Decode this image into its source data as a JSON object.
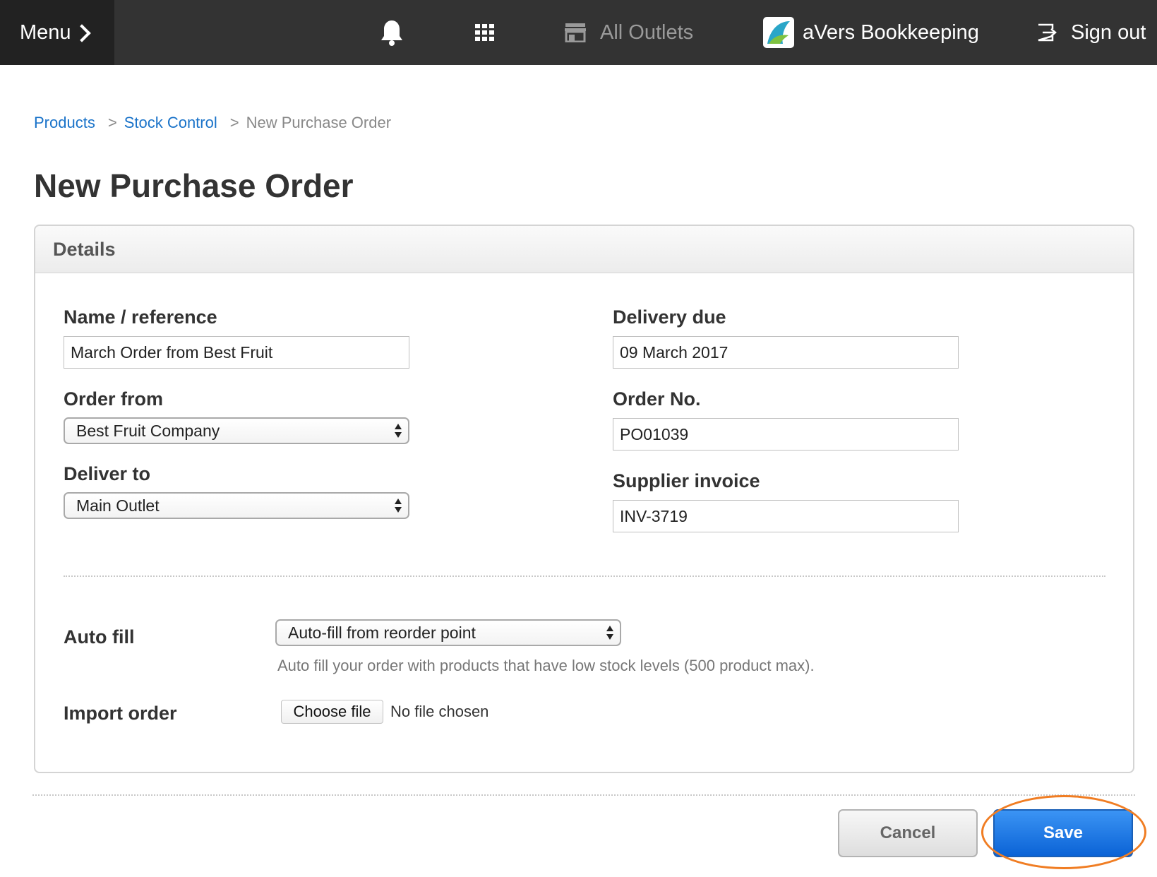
{
  "topbar": {
    "menu_label": "Menu",
    "outlets_label": "All Outlets",
    "brand_label": "aVers Bookkeeping",
    "signout_label": "Sign out",
    "bg_color": "#333333",
    "icons": [
      "bell-icon",
      "apps-grid-icon",
      "store-icon",
      "brand-logo-icon",
      "sign-out-icon"
    ]
  },
  "breadcrumb": {
    "items": [
      "Products",
      "Stock Control"
    ],
    "separator": ">",
    "current": "New Purchase Order"
  },
  "page_title": "New Purchase Order",
  "panel": {
    "header": "Details",
    "name_label": "Name / reference",
    "name_value": "March Order from Best Fruit",
    "order_from_label": "Order from",
    "order_from_value": "Best Fruit Company",
    "deliver_to_label": "Deliver to",
    "deliver_to_value": "Main Outlet",
    "delivery_due_label": "Delivery due",
    "delivery_due_value": "09 March 2017",
    "order_no_label": "Order No.",
    "order_no_value": "PO01039",
    "supplier_invoice_label": "Supplier invoice",
    "supplier_invoice_value": "INV-3719",
    "autofill_label": "Auto fill",
    "autofill_value": "Auto-fill from reorder point",
    "autofill_hint": "Auto fill your order with products that have low stock levels (500 product max).",
    "import_label": "Import order",
    "choose_file_label": "Choose file",
    "file_status": "No file chosen"
  },
  "actions": {
    "cancel_label": "Cancel",
    "save_label": "Save",
    "save_color": "#0b63d6",
    "highlight_color": "#f07d23"
  }
}
